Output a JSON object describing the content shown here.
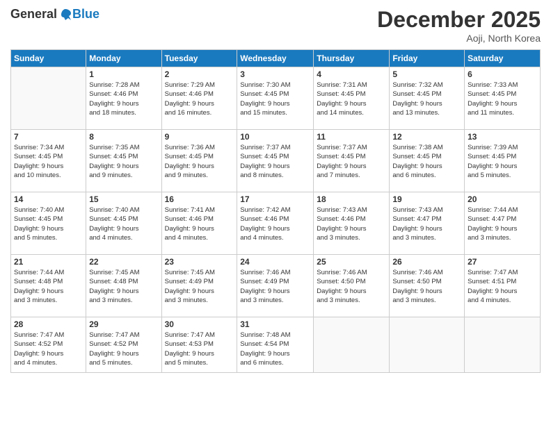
{
  "logo": {
    "general": "General",
    "blue": "Blue"
  },
  "header": {
    "month": "December 2025",
    "location": "Aoji, North Korea"
  },
  "days_of_week": [
    "Sunday",
    "Monday",
    "Tuesday",
    "Wednesday",
    "Thursday",
    "Friday",
    "Saturday"
  ],
  "weeks": [
    [
      {
        "day": "",
        "info": ""
      },
      {
        "day": "1",
        "info": "Sunrise: 7:28 AM\nSunset: 4:46 PM\nDaylight: 9 hours\nand 18 minutes."
      },
      {
        "day": "2",
        "info": "Sunrise: 7:29 AM\nSunset: 4:46 PM\nDaylight: 9 hours\nand 16 minutes."
      },
      {
        "day": "3",
        "info": "Sunrise: 7:30 AM\nSunset: 4:45 PM\nDaylight: 9 hours\nand 15 minutes."
      },
      {
        "day": "4",
        "info": "Sunrise: 7:31 AM\nSunset: 4:45 PM\nDaylight: 9 hours\nand 14 minutes."
      },
      {
        "day": "5",
        "info": "Sunrise: 7:32 AM\nSunset: 4:45 PM\nDaylight: 9 hours\nand 13 minutes."
      },
      {
        "day": "6",
        "info": "Sunrise: 7:33 AM\nSunset: 4:45 PM\nDaylight: 9 hours\nand 11 minutes."
      }
    ],
    [
      {
        "day": "7",
        "info": "Sunrise: 7:34 AM\nSunset: 4:45 PM\nDaylight: 9 hours\nand 10 minutes."
      },
      {
        "day": "8",
        "info": "Sunrise: 7:35 AM\nSunset: 4:45 PM\nDaylight: 9 hours\nand 9 minutes."
      },
      {
        "day": "9",
        "info": "Sunrise: 7:36 AM\nSunset: 4:45 PM\nDaylight: 9 hours\nand 9 minutes."
      },
      {
        "day": "10",
        "info": "Sunrise: 7:37 AM\nSunset: 4:45 PM\nDaylight: 9 hours\nand 8 minutes."
      },
      {
        "day": "11",
        "info": "Sunrise: 7:37 AM\nSunset: 4:45 PM\nDaylight: 9 hours\nand 7 minutes."
      },
      {
        "day": "12",
        "info": "Sunrise: 7:38 AM\nSunset: 4:45 PM\nDaylight: 9 hours\nand 6 minutes."
      },
      {
        "day": "13",
        "info": "Sunrise: 7:39 AM\nSunset: 4:45 PM\nDaylight: 9 hours\nand 5 minutes."
      }
    ],
    [
      {
        "day": "14",
        "info": "Sunrise: 7:40 AM\nSunset: 4:45 PM\nDaylight: 9 hours\nand 5 minutes."
      },
      {
        "day": "15",
        "info": "Sunrise: 7:40 AM\nSunset: 4:45 PM\nDaylight: 9 hours\nand 4 minutes."
      },
      {
        "day": "16",
        "info": "Sunrise: 7:41 AM\nSunset: 4:46 PM\nDaylight: 9 hours\nand 4 minutes."
      },
      {
        "day": "17",
        "info": "Sunrise: 7:42 AM\nSunset: 4:46 PM\nDaylight: 9 hours\nand 4 minutes."
      },
      {
        "day": "18",
        "info": "Sunrise: 7:43 AM\nSunset: 4:46 PM\nDaylight: 9 hours\nand 3 minutes."
      },
      {
        "day": "19",
        "info": "Sunrise: 7:43 AM\nSunset: 4:47 PM\nDaylight: 9 hours\nand 3 minutes."
      },
      {
        "day": "20",
        "info": "Sunrise: 7:44 AM\nSunset: 4:47 PM\nDaylight: 9 hours\nand 3 minutes."
      }
    ],
    [
      {
        "day": "21",
        "info": "Sunrise: 7:44 AM\nSunset: 4:48 PM\nDaylight: 9 hours\nand 3 minutes."
      },
      {
        "day": "22",
        "info": "Sunrise: 7:45 AM\nSunset: 4:48 PM\nDaylight: 9 hours\nand 3 minutes."
      },
      {
        "day": "23",
        "info": "Sunrise: 7:45 AM\nSunset: 4:49 PM\nDaylight: 9 hours\nand 3 minutes."
      },
      {
        "day": "24",
        "info": "Sunrise: 7:46 AM\nSunset: 4:49 PM\nDaylight: 9 hours\nand 3 minutes."
      },
      {
        "day": "25",
        "info": "Sunrise: 7:46 AM\nSunset: 4:50 PM\nDaylight: 9 hours\nand 3 minutes."
      },
      {
        "day": "26",
        "info": "Sunrise: 7:46 AM\nSunset: 4:50 PM\nDaylight: 9 hours\nand 3 minutes."
      },
      {
        "day": "27",
        "info": "Sunrise: 7:47 AM\nSunset: 4:51 PM\nDaylight: 9 hours\nand 4 minutes."
      }
    ],
    [
      {
        "day": "28",
        "info": "Sunrise: 7:47 AM\nSunset: 4:52 PM\nDaylight: 9 hours\nand 4 minutes."
      },
      {
        "day": "29",
        "info": "Sunrise: 7:47 AM\nSunset: 4:52 PM\nDaylight: 9 hours\nand 5 minutes."
      },
      {
        "day": "30",
        "info": "Sunrise: 7:47 AM\nSunset: 4:53 PM\nDaylight: 9 hours\nand 5 minutes."
      },
      {
        "day": "31",
        "info": "Sunrise: 7:48 AM\nSunset: 4:54 PM\nDaylight: 9 hours\nand 6 minutes."
      },
      {
        "day": "",
        "info": ""
      },
      {
        "day": "",
        "info": ""
      },
      {
        "day": "",
        "info": ""
      }
    ]
  ]
}
